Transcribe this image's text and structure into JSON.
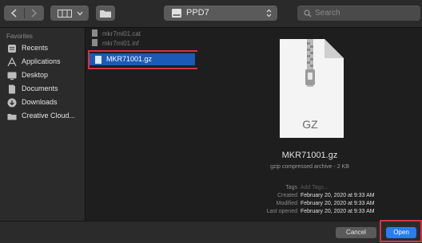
{
  "toolbar": {
    "location_label": "PPD7",
    "search_placeholder": "Search"
  },
  "sidebar": {
    "heading": "Favorites",
    "items": [
      {
        "label": "Recents",
        "icon": "recents-icon"
      },
      {
        "label": "Applications",
        "icon": "applications-icon"
      },
      {
        "label": "Desktop",
        "icon": "desktop-icon"
      },
      {
        "label": "Documents",
        "icon": "documents-icon"
      },
      {
        "label": "Downloads",
        "icon": "downloads-icon"
      },
      {
        "label": "Creative Cloud...",
        "icon": "creative-cloud-icon"
      }
    ]
  },
  "files": {
    "items": [
      {
        "name": "mkr7mi01.cat"
      },
      {
        "name": "mkr7mi01.inf"
      }
    ],
    "selected": "MKR71001.gz"
  },
  "preview": {
    "icon_text": "GZ",
    "name": "MKR71001.gz",
    "kind": "gzip compressed archive - 2 KB",
    "meta": [
      {
        "key": "Tags",
        "value": "Add Tags..."
      },
      {
        "key": "Created",
        "value": "February 20, 2020 at 9:33 AM"
      },
      {
        "key": "Modified",
        "value": "February 20, 2020 at 9:33 AM"
      },
      {
        "key": "Last opened",
        "value": "February 20, 2020 at 9:33 AM"
      }
    ]
  },
  "buttons": {
    "cancel": "Cancel",
    "open": "Open"
  },
  "colors": {
    "selection": "#1b5bb7",
    "primary_button": "#2a7cf0",
    "highlight": "#d8323e"
  }
}
